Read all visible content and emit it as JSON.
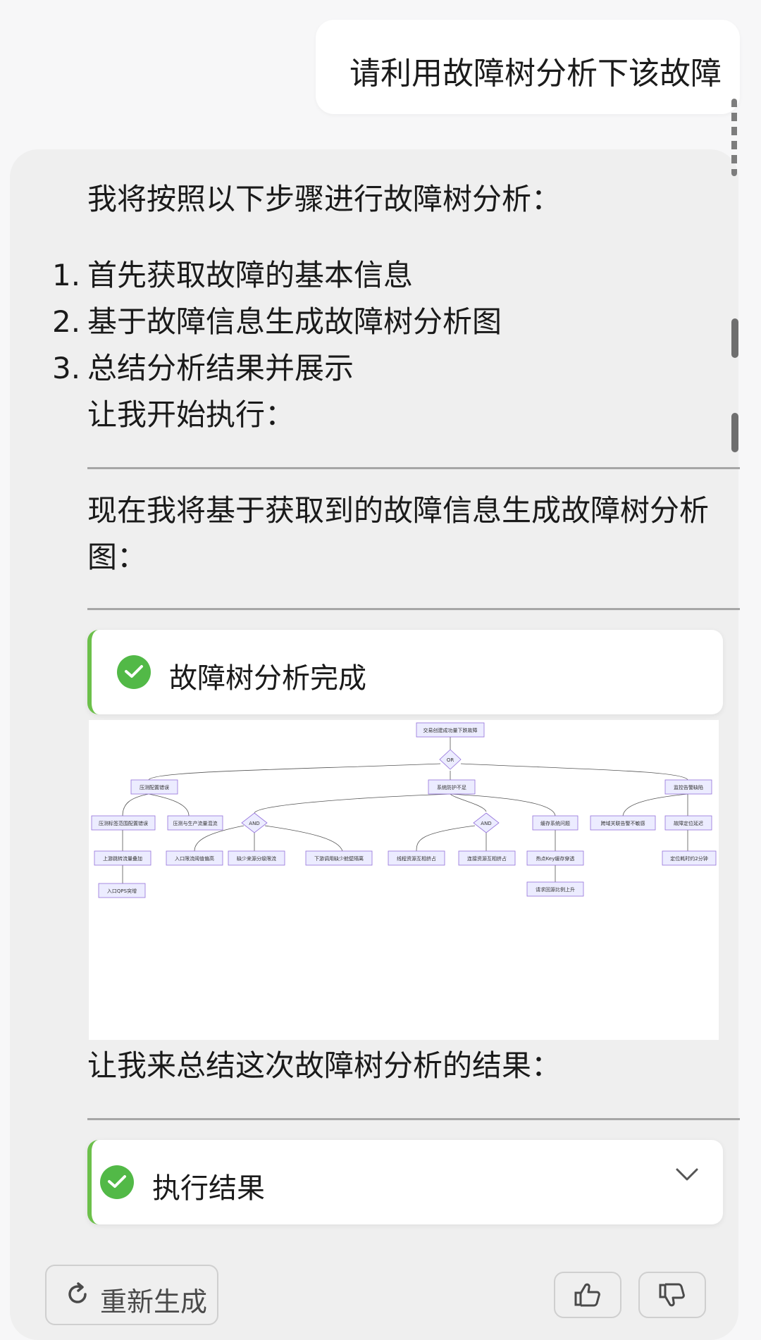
{
  "user_message": "请利用故障树分析下该故障",
  "assistant": {
    "intro": "我将按照以下步骤进行故障树分析：",
    "steps": [
      {
        "num": "1.",
        "text": "首先获取故障的基本信息"
      },
      {
        "num": "2.",
        "text": "基于故障信息生成故障树分析图"
      },
      {
        "num": "3.",
        "text": "总结分析结果并展示"
      }
    ],
    "start_text": "让我开始执行：",
    "generate_text_line1": "现在我将基于获取到的故障信息生成故障树分析",
    "generate_text_line2": "图：",
    "tool_card_1": {
      "label": "故障树分析完成",
      "icon": "check-circle-icon"
    },
    "summary_text": "让我来总结这次故障树分析的结果：",
    "tool_card_2": {
      "label": "执行结果",
      "icon": "check-circle-icon",
      "expand_icon": "chevron-down-icon"
    }
  },
  "fault_tree": {
    "top": "交易创建成功量下跌故障",
    "gate_or": "OR",
    "level1": [
      "压测配置错误",
      "系统防护不足",
      "监控告警缺陷"
    ],
    "nodes": {
      "n_pressure_tag": "压测标签范围配置错误",
      "n_pressure_mix": "压测与生产流量混流",
      "n_upstream": "上游跳转流量叠加",
      "n_qps": "入口QPS突增",
      "gate_and_1": "AND",
      "n_entry_limit": "入口限流阈值偏高",
      "n_no_degrade": "缺少来源分级限流",
      "n_downstream": "下游调用缺少舱壁隔离",
      "gate_and_2": "AND",
      "n_cache": "缓存系统问题",
      "n_thread": "线程资源互相挤占",
      "n_conn": "连接资源互相挤占",
      "n_hotkey": "热点Key缓存穿透",
      "n_backsource": "请求回源比例上升",
      "n_cross_domain": "跨域关联告警不敏感",
      "n_locate_delay": "故障定位延迟",
      "n_locate_time": "定位耗时约2分钟"
    }
  },
  "footer": {
    "regenerate_label": "重新生成",
    "regenerate_icon": "refresh-icon",
    "like_icon": "thumbs-up-icon",
    "dislike_icon": "thumbs-down-icon"
  },
  "colors": {
    "accent_green": "#52b947",
    "node_fill": "#ececff",
    "node_stroke": "#9370db"
  }
}
